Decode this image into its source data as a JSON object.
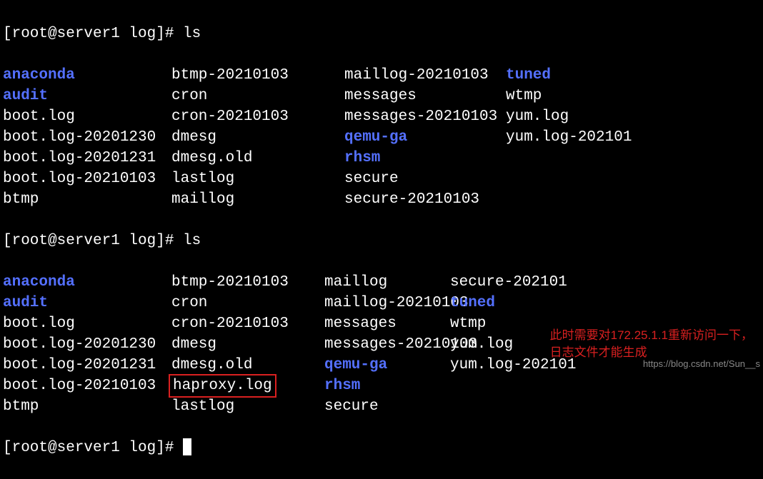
{
  "prompt1": "[root@server1 log]# ",
  "cmd1": "ls",
  "listing1": {
    "rows": [
      {
        "c1": {
          "text": "anaconda",
          "type": "dir"
        },
        "c2": {
          "text": "btmp-20210103",
          "type": "file"
        },
        "c3": {
          "text": "maillog-20210103",
          "type": "file"
        },
        "c4": {
          "text": "tuned",
          "type": "dir"
        }
      },
      {
        "c1": {
          "text": "audit",
          "type": "dir"
        },
        "c2": {
          "text": "cron",
          "type": "file"
        },
        "c3": {
          "text": "messages",
          "type": "file"
        },
        "c4": {
          "text": "wtmp",
          "type": "file"
        }
      },
      {
        "c1": {
          "text": "boot.log",
          "type": "file"
        },
        "c2": {
          "text": "cron-20210103",
          "type": "file"
        },
        "c3": {
          "text": "messages-20210103",
          "type": "file"
        },
        "c4": {
          "text": "yum.log",
          "type": "file"
        }
      },
      {
        "c1": {
          "text": "boot.log-20201230",
          "type": "file"
        },
        "c2": {
          "text": "dmesg",
          "type": "file"
        },
        "c3": {
          "text": "qemu-ga",
          "type": "dir"
        },
        "c4": {
          "text": "yum.log-202101",
          "type": "file"
        }
      },
      {
        "c1": {
          "text": "boot.log-20201231",
          "type": "file"
        },
        "c2": {
          "text": "dmesg.old",
          "type": "file"
        },
        "c3": {
          "text": "rhsm",
          "type": "dir"
        },
        "c4": {
          "text": "",
          "type": "file"
        }
      },
      {
        "c1": {
          "text": "boot.log-20210103",
          "type": "file"
        },
        "c2": {
          "text": "lastlog",
          "type": "file"
        },
        "c3": {
          "text": "secure",
          "type": "file"
        },
        "c4": {
          "text": "",
          "type": "file"
        }
      },
      {
        "c1": {
          "text": "btmp",
          "type": "file"
        },
        "c2": {
          "text": "maillog",
          "type": "file"
        },
        "c3": {
          "text": "secure-20210103",
          "type": "file"
        },
        "c4": {
          "text": "",
          "type": "file"
        }
      }
    ]
  },
  "prompt2": "[root@server1 log]# ",
  "cmd2": "ls",
  "listing2": {
    "rows": [
      {
        "c1": {
          "text": "anaconda",
          "type": "dir"
        },
        "c2": {
          "text": "btmp-20210103",
          "type": "file"
        },
        "c3": {
          "text": "maillog",
          "type": "file"
        },
        "c4": {
          "text": "secure-202101",
          "type": "file"
        }
      },
      {
        "c1": {
          "text": "audit",
          "type": "dir"
        },
        "c2": {
          "text": "cron",
          "type": "file"
        },
        "c3": {
          "text": "maillog-20210103",
          "type": "file"
        },
        "c4": {
          "text": "tuned",
          "type": "dir"
        }
      },
      {
        "c1": {
          "text": "boot.log",
          "type": "file"
        },
        "c2": {
          "text": "cron-20210103",
          "type": "file"
        },
        "c3": {
          "text": "messages",
          "type": "file"
        },
        "c4": {
          "text": "wtmp",
          "type": "file"
        }
      },
      {
        "c1": {
          "text": "boot.log-20201230",
          "type": "file"
        },
        "c2": {
          "text": "dmesg",
          "type": "file"
        },
        "c3": {
          "text": "messages-20210103",
          "type": "file"
        },
        "c4": {
          "text": "yum.log",
          "type": "file"
        }
      },
      {
        "c1": {
          "text": "boot.log-20201231",
          "type": "file"
        },
        "c2": {
          "text": "dmesg.old",
          "type": "file"
        },
        "c3": {
          "text": "qemu-ga",
          "type": "dir"
        },
        "c4": {
          "text": "yum.log-202101",
          "type": "file"
        }
      },
      {
        "c1": {
          "text": "boot.log-20210103",
          "type": "file"
        },
        "c2": {
          "text": "haproxy.log",
          "type": "file",
          "highlighted": true
        },
        "c3": {
          "text": "rhsm",
          "type": "dir"
        },
        "c4": {
          "text": "",
          "type": "file"
        }
      },
      {
        "c1": {
          "text": "btmp",
          "type": "file"
        },
        "c2": {
          "text": "lastlog",
          "type": "file"
        },
        "c3": {
          "text": "secure",
          "type": "file"
        },
        "c4": {
          "text": "",
          "type": "file"
        }
      }
    ]
  },
  "prompt3": "[root@server1 log]# ",
  "annotation": {
    "line1": "此时需要对172.25.1.1重新访问一下，",
    "line2": "日志文件才能生成"
  },
  "watermark": "https://blog.csdn.net/Sun__s"
}
